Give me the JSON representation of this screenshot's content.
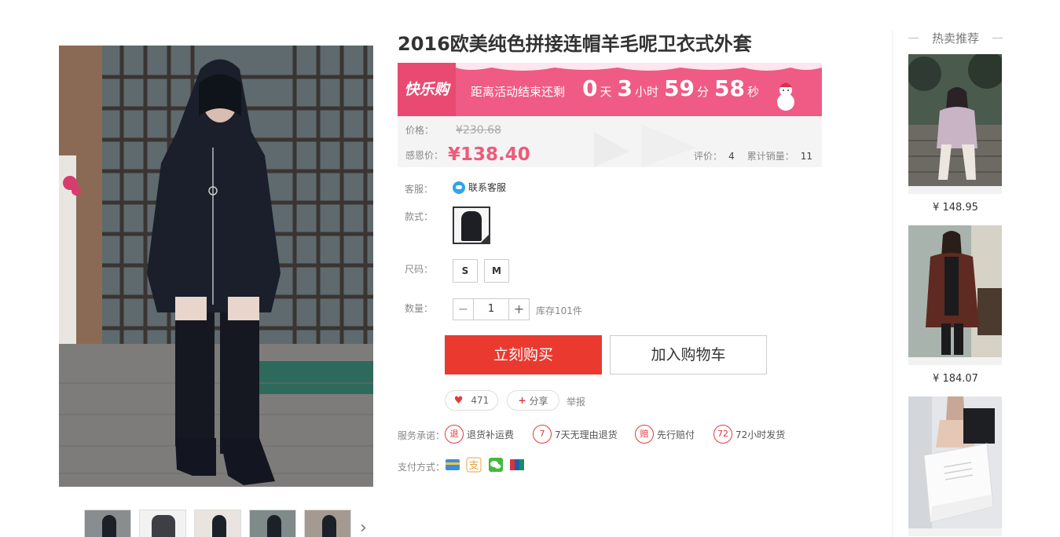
{
  "product": {
    "title": "2016欧美纯色拼接连帽羊毛呢卫衣式外套"
  },
  "promo": {
    "logo": "快乐购",
    "countdown_label": "距离活动结束还剩",
    "days": "0",
    "days_unit": "天",
    "hours": "3",
    "hours_unit": "小时",
    "minutes": "59",
    "minutes_unit": "分",
    "seconds": "58",
    "seconds_unit": "秒"
  },
  "price": {
    "original_label": "价格：",
    "original": "¥230.68",
    "current_label": "感恩价：",
    "current": "¥138.40",
    "reviews_label": "评价：",
    "reviews": "4",
    "sales_label": "累计销量：",
    "sales": "11"
  },
  "service": {
    "label": "客服：",
    "link": "联系客服"
  },
  "style": {
    "label": "款式："
  },
  "size": {
    "label": "尺码：",
    "options": [
      "S",
      "M"
    ]
  },
  "quantity": {
    "label": "数量：",
    "minus": "−",
    "value": "1",
    "plus": "+",
    "stock": "库存101件"
  },
  "actions": {
    "buy": "立刻购买",
    "cart": "加入购物车",
    "like_count": "471",
    "share": "分享",
    "report": "举报"
  },
  "promises": {
    "label": "服务承诺：",
    "items": [
      {
        "badge": "退",
        "text": "退货补运费"
      },
      {
        "badge": "7",
        "text": "7天无理由退货"
      },
      {
        "badge": "赔",
        "text": "先行赔付"
      },
      {
        "badge": "72",
        "text": "72小时发货"
      }
    ]
  },
  "payment": {
    "label": "支付方式：",
    "methods": [
      {
        "icon": "bank-card-icon",
        "color": "#3b8fd8"
      },
      {
        "icon": "alipay-icon",
        "color": "#e8a33c"
      },
      {
        "icon": "wechat-pay-icon",
        "color": "#43b83b"
      },
      {
        "icon": "unionpay-icon",
        "color": "#d8343c"
      }
    ]
  },
  "hot": {
    "title": "热卖推荐",
    "items": [
      {
        "price": "¥ 148.95"
      },
      {
        "price": "¥ 184.07"
      },
      {
        "price": ""
      }
    ]
  },
  "colors": {
    "promo_pink": "#ef5b84",
    "price_pink": "#ee5a7a",
    "buy_red": "#ea3a30"
  }
}
